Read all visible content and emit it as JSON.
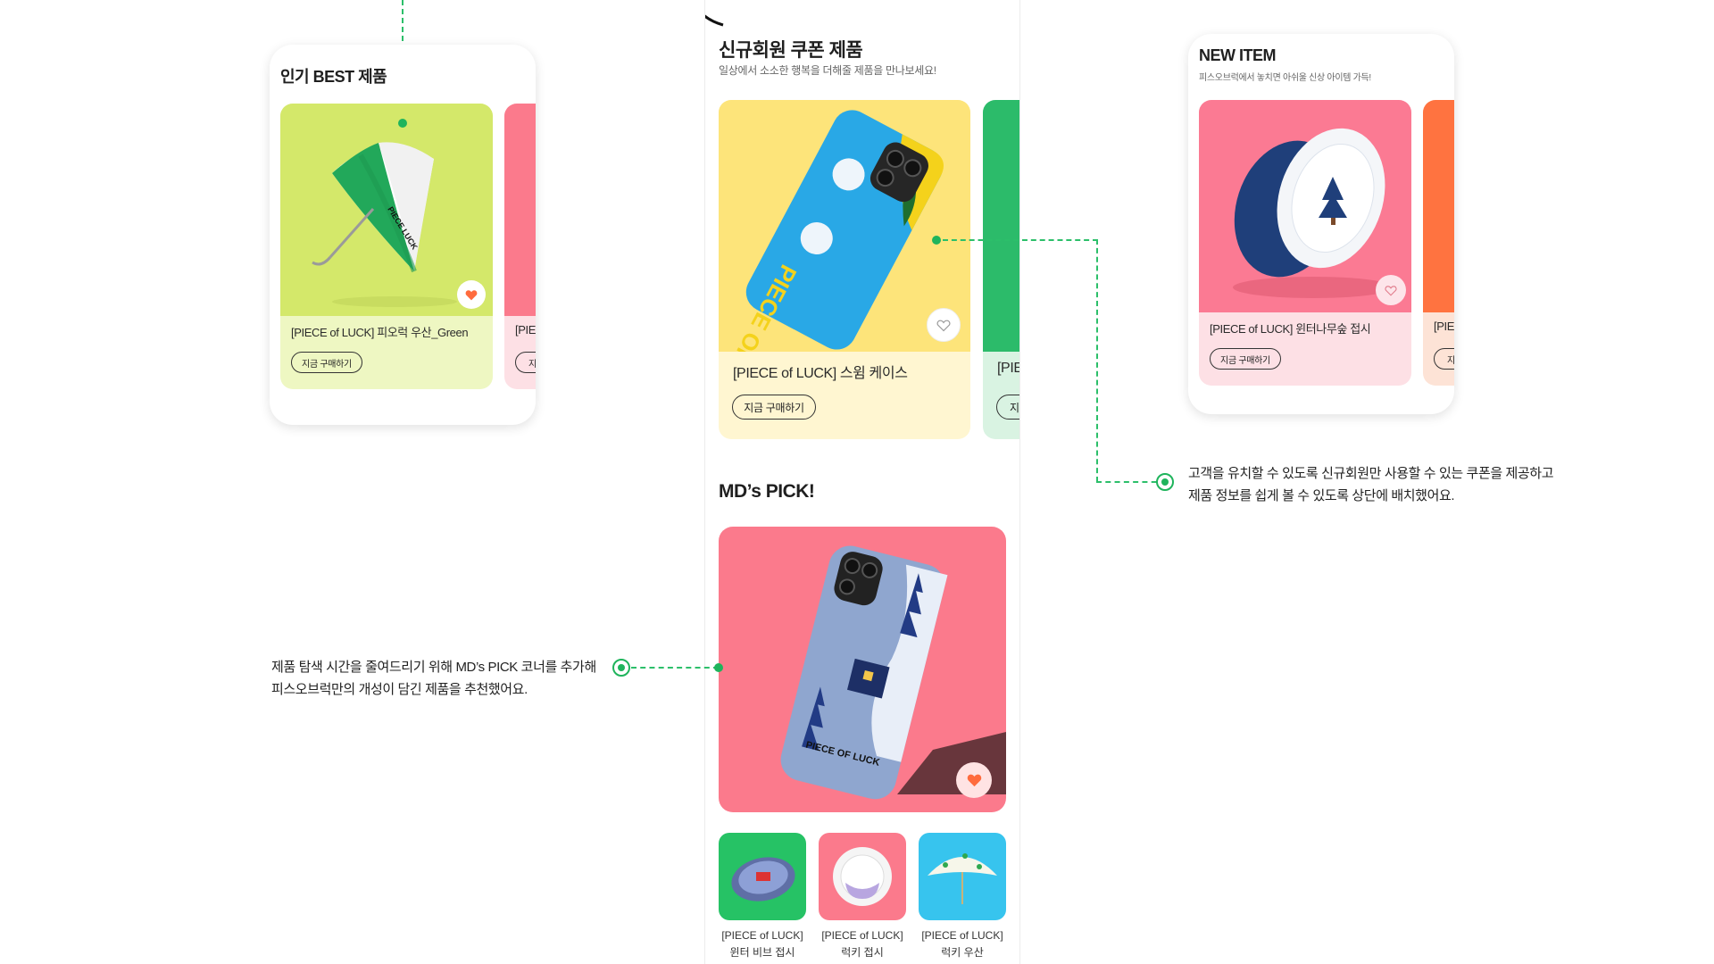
{
  "best_panel": {
    "title": "인기 BEST 제품",
    "product": {
      "name": "[PIECE of LUCK] 피오럭 우산_Green",
      "buy_label": "지금 구매하기"
    },
    "peek": {
      "name": "[PIE",
      "buy_label": "지"
    }
  },
  "coupon_section": {
    "title": "신규회원 쿠폰 제품",
    "subtitle": "일상에서 소소한 행복을 더해줄 제품을 만나보세요!",
    "product": {
      "name": "[PIECE of LUCK] 스윔 케이스",
      "buy_label": "지금 구매하기",
      "art_text": "PIECE OF LUCK"
    },
    "peek": {
      "name": "[PIE",
      "buy_label": "지"
    }
  },
  "md_pick": {
    "title": "MD’s PICK!",
    "main_art_text": "PIECE OF LUCK",
    "thumbs": [
      {
        "line1": "[PIECE of LUCK]",
        "line2": "윈터 비브 접시"
      },
      {
        "line1": "[PIECE of LUCK]",
        "line2": "럭키 접시"
      },
      {
        "line1": "[PIECE of LUCK]",
        "line2": "럭키 우산"
      }
    ]
  },
  "new_panel": {
    "title": "NEW ITEM",
    "subtitle": "피스오브럭에서 놓치면 아쉬울 신상 아이템 가득!",
    "product": {
      "name": "[PIECE of LUCK] 윈터나무숲 접시",
      "buy_label": "지금 구매하기"
    },
    "peek": {
      "name": "[PIE",
      "buy_label": "지"
    }
  },
  "annotations": {
    "coupon_line1": "고객을 유치할 수 있도록 신규회원만 사용할 수 있는 쿠폰을 제공하고",
    "coupon_line2": "제품 정보를 쉽게 볼 수 있도록 상단에 배치했어요.",
    "mdpick_line1": "제품 탐색 시간을 줄여드리기 위해 MD’s PICK 코너를 추가해",
    "mdpick_line2": "피스오브럭만의 개성이 담긴 제품을 추천했어요."
  },
  "colors": {
    "accent_green": "#1fb45c",
    "best_card_bg": "#eef7c2",
    "best_img_bg": "#d4e86a",
    "coupon_card_bg": "#fff6d1",
    "coupon_img_bg": "#fde47a",
    "md_pick_bg": "#fb7a8c",
    "new_card_bg": "#fde0e5",
    "new_img_bg": "#fb7a93",
    "heart_orange": "#ff6b3d"
  },
  "icons": [
    "heart-filled-icon",
    "heart-outline-icon"
  ]
}
